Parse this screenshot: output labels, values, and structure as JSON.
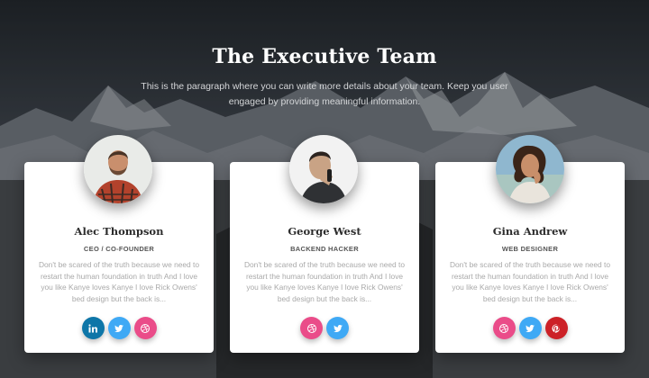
{
  "header": {
    "title": "The Executive Team",
    "subtitle": "This is the paragraph where you can write more details about your team. Keep you user engaged by providing meaningful information."
  },
  "colors": {
    "linkedin": "#0e76a8",
    "twitter": "#3fa9f5",
    "dribbble": "#ea4c89",
    "pinterest": "#cc2127"
  },
  "team": [
    {
      "name": "Alec Thompson",
      "role": "CEO / CO-FOUNDER",
      "description": "Don't be scared of the truth because we need to restart the human foundation in truth And I love you like Kanye loves Kanye I love Rick Owens' bed design but the back is...",
      "socials": [
        "linkedin-icon",
        "twitter-icon",
        "dribbble-icon"
      ]
    },
    {
      "name": "George West",
      "role": "BACKEND HACKER",
      "description": "Don't be scared of the truth because we need to restart the human foundation in truth And I love you like Kanye loves Kanye I love Rick Owens' bed design but the back is...",
      "socials": [
        "dribbble-icon",
        "twitter-icon"
      ]
    },
    {
      "name": "Gina Andrew",
      "role": "WEB DESIGNER",
      "description": "Don't be scared of the truth because we need to restart the human foundation in truth And I love you like Kanye loves Kanye I love Rick Owens' bed design but the back is...",
      "socials": [
        "dribbble-icon",
        "twitter-icon",
        "pinterest-icon"
      ]
    }
  ]
}
